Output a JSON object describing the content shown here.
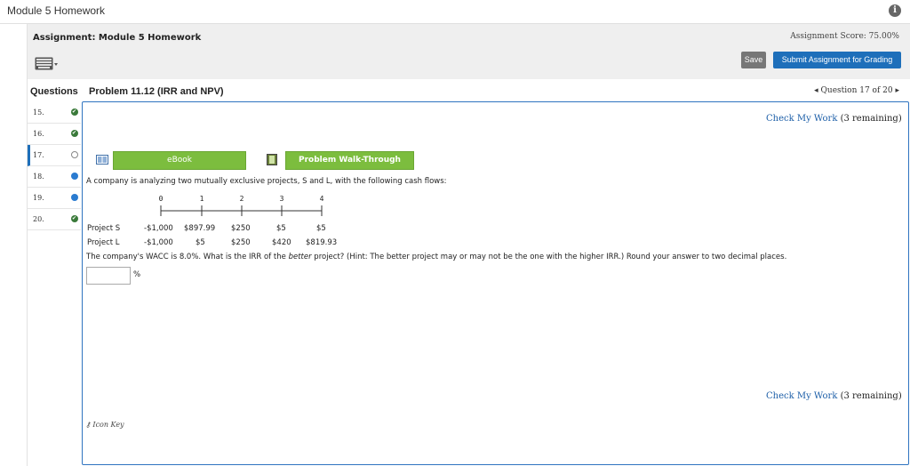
{
  "window": {
    "title": "Module 5 Homework",
    "info_icon": "info-icon"
  },
  "header": {
    "assignment_label": "Assignment: Module 5 Homework",
    "score": "Assignment Score: 75.00%",
    "save_label": "Save",
    "submit_label": "Submit Assignment for Grading"
  },
  "questions": {
    "heading": "Questions",
    "items": [
      {
        "number": "15.",
        "status": "complete"
      },
      {
        "number": "16.",
        "status": "complete"
      },
      {
        "number": "17.",
        "status": "unanswered"
      },
      {
        "number": "18.",
        "status": "partial"
      },
      {
        "number": "19.",
        "status": "partial"
      },
      {
        "number": "20.",
        "status": "complete"
      }
    ]
  },
  "problem": {
    "title": "Problem 11.12 (IRR and NPV)",
    "nav": "◂ Question 17 of 20 ▸",
    "check_link": "Check My Work",
    "check_remaining": " (3 remaining)",
    "ebook_label": "eBook",
    "walkthrough_label": "Problem Walk-Through",
    "intro": "A company is analyzing two mutually exclusive projects, S and L, with the following cash flows:",
    "periods": [
      "0",
      "1",
      "2",
      "3",
      "4"
    ],
    "project_s_label": "Project S",
    "project_s_values": [
      "-$1,000",
      "$897.99",
      "$250",
      "$5",
      "$5"
    ],
    "project_l_label": "Project L",
    "project_l_values": [
      "-$1,000",
      "$5",
      "$250",
      "$420",
      "$819.93"
    ],
    "question_pre": "The company's WACC is 8.0%. What is the IRR of the ",
    "question_em": "better",
    "question_post": " project? (Hint: The better project may or may not be the one with the higher IRR.) Round your answer to two decimal places.",
    "answer_value": "",
    "unit": "%",
    "icon_key": "Icon Key"
  },
  "colors": {
    "accent": "#1e6fba",
    "green": "#7cbd3e",
    "complete": "#3a7a3a",
    "partial": "#2a7bd0"
  }
}
